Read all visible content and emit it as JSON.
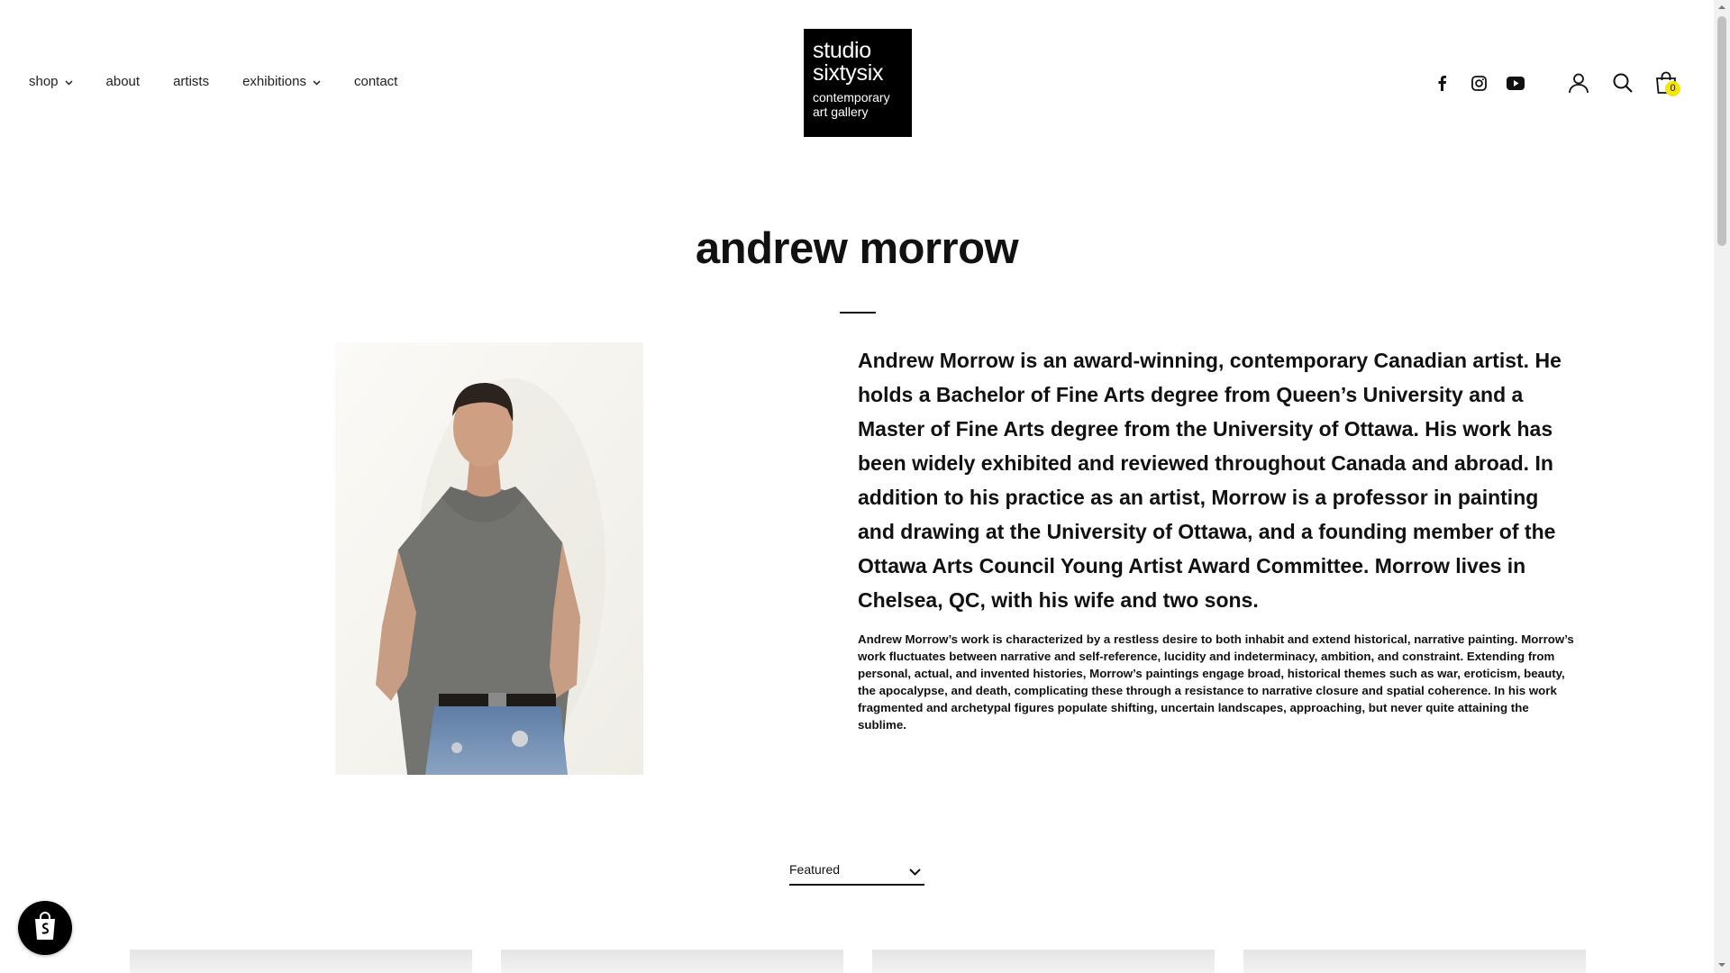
{
  "header": {
    "nav": [
      {
        "label": "shop",
        "dropdown": true
      },
      {
        "label": "about",
        "dropdown": false
      },
      {
        "label": "artists",
        "dropdown": false
      },
      {
        "label": "exhibitions",
        "dropdown": true
      },
      {
        "label": "contact",
        "dropdown": false
      }
    ],
    "logo": {
      "line1": "studio",
      "line2": "sixtysix",
      "line3": "contemporary",
      "line4": "art gallery"
    },
    "social_icons": [
      "facebook-icon",
      "instagram-icon",
      "youtube-icon"
    ],
    "utility_icons": [
      "account-icon",
      "search-icon",
      "cart-icon"
    ],
    "cart_count": "0"
  },
  "artist": {
    "name": "andrew morrow",
    "bio_lead": "Andrew Morrow is an award-winning, contemporary Canadian artist. He holds a Bachelor of Fine Arts degree from Queen’s University and a Master of Fine Arts degree from the University of Ottawa. His work has been widely exhibited and reviewed throughout Canada and abroad. In addition to his practice as an artist, Morrow is a professor in painting and drawing at the University of Ottawa, and a founding member of the Ottawa Arts Council Young Artist Award Committee. Morrow lives in Chelsea, QC, with his wife and two sons.",
    "bio_body": "Andrew Morrow’s work is characterized by a restless desire to both inhabit and extend historical, narrative painting. Morrow’s work fluctuates between narrative and self-reference, lucidity and indeterminacy, ambition, and constraint. Extending from personal, actual, and invented histories, Morrow’s paintings engage broad, historical themes such as war, eroticism, beauty, the apocalypse, and death, complicating these through a resistance to narrative closure and spatial coherence. In his work fragmented and archetypal figures populate shifting, uncertain landscapes, approaching, but never quite attaining the sublime."
  },
  "sort": {
    "selected": "Featured"
  },
  "colors": {
    "cart_badge": "#f5e60a",
    "logo_bg": "#000000",
    "text": "#111111"
  }
}
